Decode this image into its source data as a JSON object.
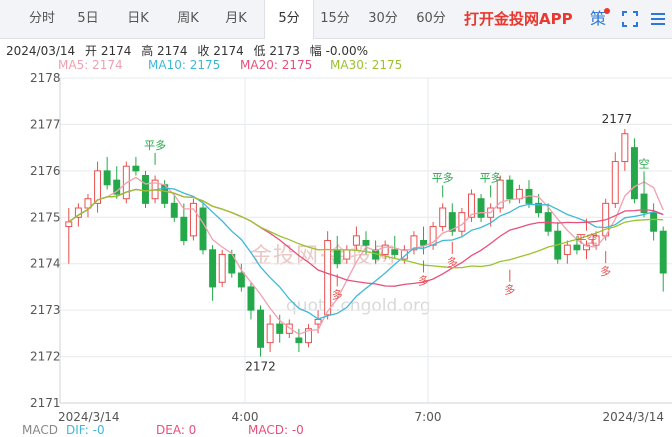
{
  "tabs": [
    "分时",
    "5日",
    "日K",
    "周K",
    "月K",
    "5分",
    "15分",
    "30分",
    "60分"
  ],
  "active_tab": 5,
  "promo_text": "打开金投网APP",
  "controls": {
    "strategy_glyph": "策",
    "fullscreen_icon": "fullscreen-icon",
    "more_icon": "more-icon"
  },
  "info": {
    "date": "2024/03/14",
    "open": "开 2174",
    "high": "高 2174",
    "close": "收 2174",
    "low": "低 2173",
    "change": "幅 -0.00%"
  },
  "ma": [
    {
      "label": "MA5: 2174",
      "color": "#f0a0b0"
    },
    {
      "label": "MA10: 2175",
      "color": "#3fb8d8"
    },
    {
      "label": "MA20: 2175",
      "color": "#e8507a"
    },
    {
      "label": "MA30: 2175",
      "color": "#9cc230"
    }
  ],
  "y_ticks": [
    "2178",
    "2177",
    "2176",
    "2175",
    "2174",
    "2173",
    "2172",
    "2171"
  ],
  "x_ticks": [
    "2024/3/14",
    "4:00",
    "7:00",
    "2024/3/14"
  ],
  "annotations": {
    "high_label": "2177",
    "low_label": "2172",
    "close_label": "平多",
    "open_label": "多",
    "short_close_label": "平空",
    "short_open_label": "空"
  },
  "macd": {
    "title": "MACD",
    "dif": "DIF: -0",
    "dea": "DEA: 0",
    "macd": "MACD: -0",
    "colors": {
      "dif": "#3fb8d8",
      "dea": "#e8507a",
      "macd": "#e8507a"
    }
  },
  "watermark": {
    "brand": "金投网·金投网",
    "url": "quote.cngold.org"
  },
  "colors": {
    "up": "#e8504f",
    "down": "#24a84a",
    "accent": "#2b78d6",
    "grid": "#e6e9ed"
  },
  "chart_data": {
    "type": "candlestick",
    "y_range": [
      2171,
      2178
    ],
    "candles": [
      [
        2174.8,
        2175.2,
        2174.0,
        2174.9
      ],
      [
        2175.0,
        2175.3,
        2174.8,
        2175.2
      ],
      [
        2175.2,
        2175.5,
        2175.0,
        2175.4
      ],
      [
        2175.3,
        2176.2,
        2175.1,
        2176.0
      ],
      [
        2176.0,
        2176.3,
        2175.6,
        2175.7
      ],
      [
        2175.8,
        2176.1,
        2175.4,
        2175.5
      ],
      [
        2175.4,
        2176.2,
        2175.3,
        2176.1
      ],
      [
        2176.1,
        2176.3,
        2175.9,
        2176.0
      ],
      [
        2175.9,
        2176.0,
        2175.2,
        2175.3
      ],
      [
        2175.4,
        2175.9,
        2175.3,
        2175.8
      ],
      [
        2175.7,
        2175.8,
        2175.2,
        2175.3
      ],
      [
        2175.3,
        2175.5,
        2174.9,
        2175.0
      ],
      [
        2175.0,
        2175.3,
        2174.4,
        2174.5
      ],
      [
        2174.6,
        2175.4,
        2174.5,
        2175.3
      ],
      [
        2175.2,
        2175.3,
        2174.2,
        2174.3
      ],
      [
        2174.3,
        2174.4,
        2173.2,
        2173.5
      ],
      [
        2173.6,
        2174.3,
        2173.5,
        2174.2
      ],
      [
        2174.2,
        2174.3,
        2173.7,
        2173.8
      ],
      [
        2173.8,
        2174.0,
        2173.4,
        2173.5
      ],
      [
        2173.5,
        2173.6,
        2172.8,
        2173.0
      ],
      [
        2173.0,
        2173.1,
        2172.0,
        2172.2
      ],
      [
        2172.3,
        2172.9,
        2172.1,
        2172.7
      ],
      [
        2172.7,
        2172.9,
        2172.3,
        2172.5
      ],
      [
        2172.5,
        2172.8,
        2172.4,
        2172.7
      ],
      [
        2172.4,
        2172.6,
        2172.1,
        2172.3
      ],
      [
        2172.3,
        2172.7,
        2172.2,
        2172.6
      ],
      [
        2172.7,
        2173.0,
        2172.5,
        2172.8
      ],
      [
        2172.9,
        2174.7,
        2172.8,
        2174.5
      ],
      [
        2174.3,
        2174.6,
        2173.9,
        2174.0
      ],
      [
        2174.1,
        2174.4,
        2174.0,
        2174.3
      ],
      [
        2174.4,
        2174.8,
        2174.3,
        2174.6
      ],
      [
        2174.5,
        2174.7,
        2174.2,
        2174.4
      ],
      [
        2174.3,
        2174.5,
        2174.0,
        2174.1
      ],
      [
        2174.2,
        2174.5,
        2174.1,
        2174.4
      ],
      [
        2174.3,
        2174.6,
        2174.1,
        2174.2
      ],
      [
        2174.1,
        2174.4,
        2174.0,
        2174.3
      ],
      [
        2174.3,
        2174.7,
        2174.2,
        2174.6
      ],
      [
        2174.5,
        2174.8,
        2174.2,
        2174.4
      ],
      [
        2174.4,
        2174.9,
        2174.3,
        2174.8
      ],
      [
        2174.8,
        2175.3,
        2174.7,
        2175.2
      ],
      [
        2175.1,
        2175.3,
        2174.6,
        2174.7
      ],
      [
        2174.7,
        2175.2,
        2174.6,
        2175.1
      ],
      [
        2175.0,
        2175.6,
        2174.9,
        2175.5
      ],
      [
        2175.4,
        2175.5,
        2174.9,
        2175.0
      ],
      [
        2175.0,
        2175.3,
        2174.8,
        2175.2
      ],
      [
        2175.2,
        2175.9,
        2175.1,
        2175.8
      ],
      [
        2175.8,
        2175.9,
        2175.3,
        2175.4
      ],
      [
        2175.4,
        2175.7,
        2175.3,
        2175.6
      ],
      [
        2175.6,
        2175.8,
        2175.2,
        2175.3
      ],
      [
        2175.3,
        2175.5,
        2175.0,
        2175.1
      ],
      [
        2175.1,
        2175.3,
        2174.6,
        2174.7
      ],
      [
        2174.7,
        2174.9,
        2174.0,
        2174.1
      ],
      [
        2174.2,
        2174.5,
        2174.0,
        2174.4
      ],
      [
        2174.4,
        2174.6,
        2174.2,
        2174.3
      ],
      [
        2174.3,
        2174.5,
        2174.1,
        2174.4
      ],
      [
        2174.4,
        2174.7,
        2174.3,
        2174.6
      ],
      [
        2174.6,
        2175.4,
        2174.5,
        2175.3
      ],
      [
        2175.3,
        2176.4,
        2175.2,
        2176.2
      ],
      [
        2176.2,
        2176.9,
        2176.0,
        2176.8
      ],
      [
        2176.5,
        2176.7,
        2175.3,
        2175.4
      ],
      [
        2175.5,
        2175.9,
        2175.0,
        2175.1
      ],
      [
        2175.1,
        2175.3,
        2174.5,
        2174.7
      ],
      [
        2174.7,
        2174.8,
        2173.4,
        2173.8
      ]
    ]
  }
}
